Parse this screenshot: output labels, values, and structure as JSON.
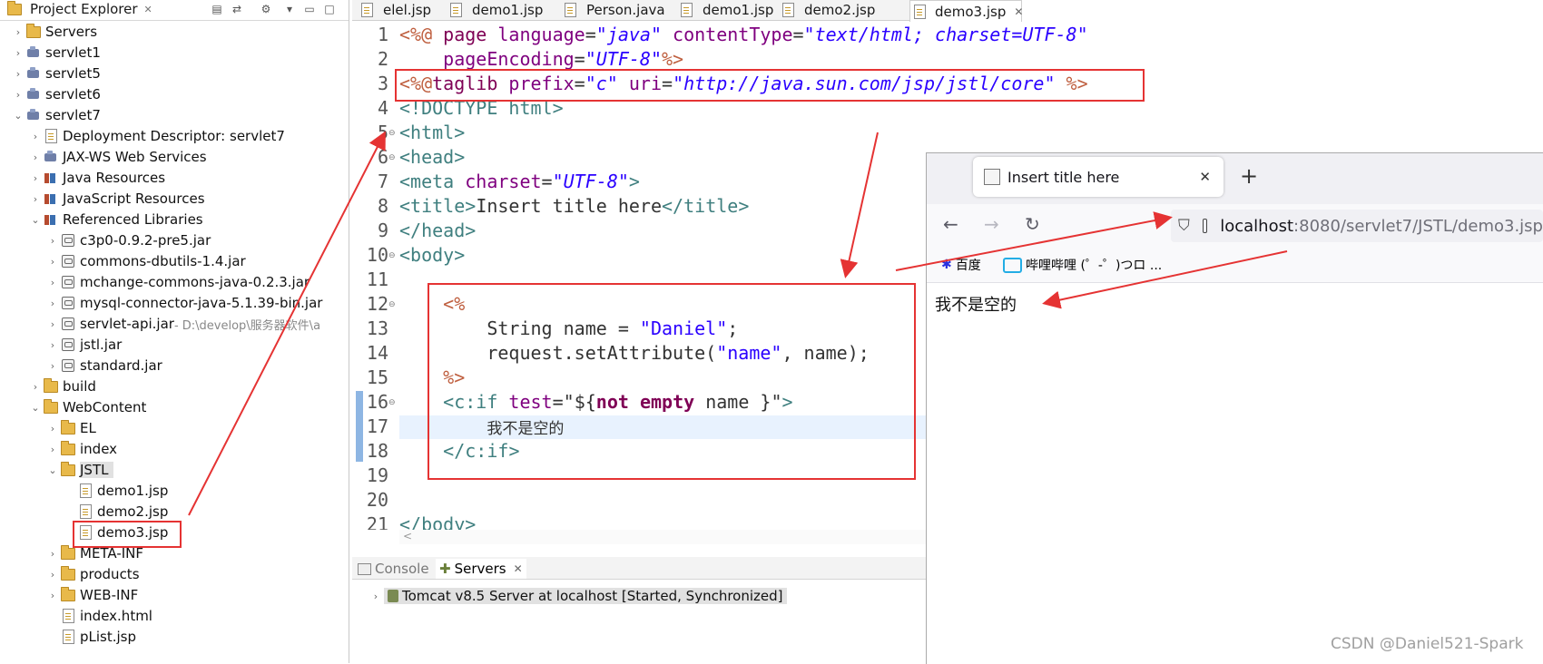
{
  "project_explorer": {
    "title": "Project Explorer",
    "close": "✕",
    "items": [
      {
        "label": "Servers",
        "icon": "folder-icon",
        "twisty": "›"
      },
      {
        "label": "servlet1",
        "icon": "project-icon",
        "twisty": "›"
      },
      {
        "label": "servlet5",
        "icon": "project-icon",
        "twisty": "›"
      },
      {
        "label": "servlet6",
        "icon": "project-icon",
        "twisty": "›"
      },
      {
        "label": "servlet7",
        "icon": "project-icon",
        "twisty": "⌄"
      },
      {
        "label": "Deployment Descriptor: servlet7",
        "icon": "descriptor-icon",
        "twisty": "›"
      },
      {
        "label": "JAX-WS Web Services",
        "icon": "webservices-icon",
        "twisty": "›"
      },
      {
        "label": "Java Resources",
        "icon": "java-resources-icon",
        "twisty": "›"
      },
      {
        "label": "JavaScript Resources",
        "icon": "javascript-resources-icon",
        "twisty": "›"
      },
      {
        "label": "Referenced Libraries",
        "icon": "library-icon",
        "twisty": "⌄"
      },
      {
        "label": "c3p0-0.9.2-pre5.jar",
        "icon": "jar-icon",
        "twisty": "›"
      },
      {
        "label": "commons-dbutils-1.4.jar",
        "icon": "jar-icon",
        "twisty": "›"
      },
      {
        "label": "mchange-commons-java-0.2.3.jar",
        "icon": "jar-icon",
        "twisty": "›"
      },
      {
        "label": "mysql-connector-java-5.1.39-bin.jar",
        "icon": "jar-icon",
        "twisty": "›"
      },
      {
        "label": "servlet-api.jar",
        "extra": " - D:\\develop\\服务器软件\\a",
        "icon": "jar-icon",
        "twisty": "›"
      },
      {
        "label": "jstl.jar",
        "icon": "jar-icon",
        "twisty": "›"
      },
      {
        "label": "standard.jar",
        "icon": "jar-icon",
        "twisty": "›"
      },
      {
        "label": "build",
        "icon": "folder-icon",
        "twisty": "›"
      },
      {
        "label": "WebContent",
        "icon": "folder-icon",
        "twisty": "⌄"
      },
      {
        "label": "EL",
        "icon": "folder-icon",
        "twisty": "›"
      },
      {
        "label": "index",
        "icon": "folder-icon",
        "twisty": "›"
      },
      {
        "label": "JSTL",
        "icon": "folder-icon",
        "twisty": "⌄"
      },
      {
        "label": "demo1.jsp",
        "icon": "jsp-file-icon",
        "twisty": ""
      },
      {
        "label": "demo2.jsp",
        "icon": "jsp-file-icon",
        "twisty": ""
      },
      {
        "label": "demo3.jsp",
        "icon": "jsp-file-icon",
        "twisty": ""
      },
      {
        "label": "META-INF",
        "icon": "folder-icon",
        "twisty": "›"
      },
      {
        "label": "products",
        "icon": "folder-icon",
        "twisty": "›"
      },
      {
        "label": "WEB-INF",
        "icon": "folder-icon",
        "twisty": "›"
      },
      {
        "label": "index.html",
        "icon": "html-file-icon",
        "twisty": ""
      },
      {
        "label": "pList.jsp",
        "icon": "jsp-file-icon",
        "twisty": ""
      }
    ]
  },
  "editor": {
    "tabs": [
      {
        "label": "elel.jsp",
        "icon": "jsp-file-icon"
      },
      {
        "label": "demo1.jsp",
        "icon": "jsp-file-icon"
      },
      {
        "label": "Person.java",
        "icon": "java-file-icon"
      },
      {
        "label": "demo1.jsp",
        "icon": "jsp-file-icon"
      },
      {
        "label": "demo2.jsp",
        "icon": "jsp-file-icon"
      },
      {
        "label": "demo3.jsp",
        "icon": "jsp-file-icon",
        "active": true,
        "close": "✕"
      }
    ],
    "line_numbers": [
      "1",
      "2",
      "3",
      "4",
      "5",
      "6",
      "7",
      "8",
      "9",
      "10",
      "11",
      "12",
      "13",
      "14",
      "15",
      "16",
      "17",
      "18",
      "19",
      "20",
      "21"
    ],
    "code": {
      "l1": {
        "a": "<%@",
        "b": " page ",
        "c": "language",
        "d": "=",
        "e": "\"java\"",
        "f": " contentType",
        "g": "=",
        "h": "\"text/html; charset=UTF-8\""
      },
      "l2": {
        "a": "    pageEncoding",
        "b": "=",
        "c": "\"UTF-8\"",
        "d": "%>"
      },
      "l3": {
        "a": "<%@",
        "b": "taglib ",
        "c": "prefix",
        "d": "=",
        "e": "\"c\"",
        "f": " uri",
        "g": "=",
        "h": "\"http://java.sun.com/jsp/jstl/core\"",
        "i": " %>"
      },
      "l4": {
        "a": "<!DOCTYPE ",
        "b": "html",
        "c": ">"
      },
      "l5": {
        "a": "<",
        "b": "html",
        "c": ">"
      },
      "l6": {
        "a": "<",
        "b": "head",
        "c": ">"
      },
      "l7": {
        "a": "<",
        "b": "meta",
        "c": " charset",
        "d": "=",
        "e": "\"UTF-8\"",
        "f": ">"
      },
      "l8": {
        "a": "<",
        "b": "title",
        "c": ">",
        "d": "Insert title here",
        "e": "</",
        "f": "title",
        "g": ">"
      },
      "l9": {
        "a": "</",
        "b": "head",
        "c": ">"
      },
      "l10": {
        "a": "<",
        "b": "body",
        "c": ">"
      },
      "l12": {
        "a": "<%"
      },
      "l13": {
        "a": "String name = ",
        "b": "\"Daniel\"",
        "c": ";"
      },
      "l14": {
        "a": "request.setAttribute(",
        "b": "\"name\"",
        "c": ", name);"
      },
      "l15": {
        "a": "%>"
      },
      "l16": {
        "a": "<",
        "b": "c:if",
        "c": " test",
        "d": "=",
        "e": "\"${",
        "f": "not empty",
        "g": " name ",
        "h": "}\"",
        "i": ">"
      },
      "l17": {
        "a": "我不是空的"
      },
      "l18": {
        "a": "</",
        "b": "c:if",
        "c": ">"
      },
      "l21": {
        "a": "</",
        "b": "body",
        "c": ">"
      }
    },
    "scroll_left": "<"
  },
  "bottom_panel": {
    "tabs": [
      {
        "label": "Console",
        "icon": "console-icon"
      },
      {
        "label": "Servers",
        "icon": "servers-icon",
        "close": "✕"
      }
    ],
    "server_row": "Tomcat v8.5 Server at localhost  [Started, Synchronized]"
  },
  "browser": {
    "tab_title": "Insert title here",
    "tab_close": "✕",
    "new_tab": "+",
    "url_host": "localhost",
    "url_path": ":8080/servlet7/JSTL/demo3.jsp",
    "bookmarks": [
      {
        "label": "百度",
        "icon": "baidu-icon"
      },
      {
        "label": "哔哩哔哩 (゜-゜)つロ ...",
        "icon": "bilibili-icon"
      }
    ],
    "page_text": "我不是空的"
  },
  "watermark": "CSDN @Daniel521-Spark",
  "colors": {
    "annotation_red": "#e53333",
    "keyword": "#7f0055",
    "string": "#2a00ff",
    "tag": "#3f7f7f"
  }
}
